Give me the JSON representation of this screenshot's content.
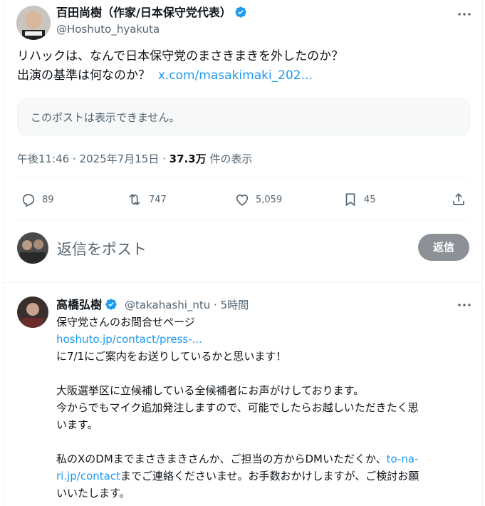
{
  "main_tweet": {
    "author_name": "百田尚樹（作家/日本保守党代表）",
    "author_handle": "@Hoshuto_hyakuta",
    "text_line1": "リハックは、なんで日本保守党のまさきまきを外したのか？",
    "text_line2": "出演の基準は何なのか？",
    "text_link": "x.com/masakimaki_202...",
    "quoted_unavailable": "このポストは表示できません。",
    "time": "午後11:46 · 2025年7月15日 · ",
    "views_count": "37.3万",
    "views_suffix": " 件の表示",
    "stats": {
      "replies": "89",
      "reposts": "747",
      "likes": "5,059",
      "bookmarks": "45"
    }
  },
  "compose": {
    "placeholder": "返信をポスト",
    "button_label": "返信"
  },
  "reply": {
    "author_name": "高橋弘樹",
    "author_handle": "@takahashi_ntu",
    "dot": " · ",
    "time": "5時間",
    "line1": "保守党さんのお問合せページ",
    "link1": "hoshuto.jp/contact/press-...",
    "line2": "に7/1にご案内をお送りしているかと思います！",
    "line3": "大阪選挙区に立候補している全候補者にお声がけしております。",
    "line4": "今からでもマイク追加発注しますので、可能でしたらお越しいただきたく思",
    "line5": "います。",
    "line6a": "私のXのDMまでまさきまきさんか、ご担当の方からDMいただくか、",
    "link2a": "to-na-",
    "link2b": "ri.jp/contact",
    "line7": "までご連絡くださいませ。お手数おかけしますが、ご検討お願",
    "line8": "いいたします。"
  },
  "colors": {
    "accent": "#1d9bf0",
    "verified": "#1d9bf0",
    "text_secondary": "#536471",
    "reply_button": "#8b9196"
  }
}
